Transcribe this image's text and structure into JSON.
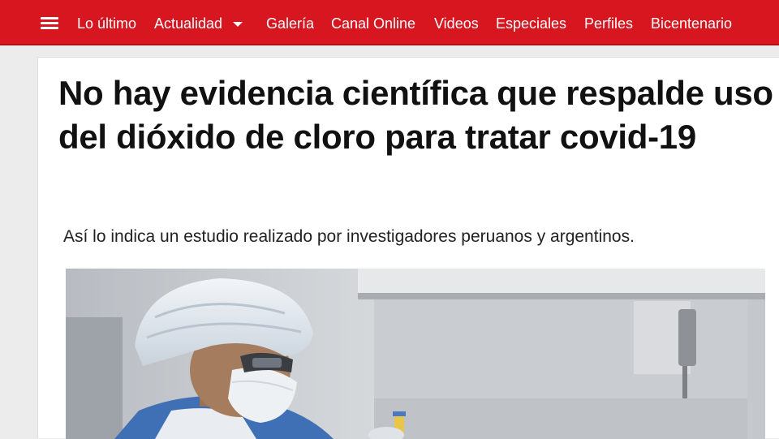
{
  "nav": {
    "items": [
      {
        "label": "Lo último"
      },
      {
        "label": "Actualidad"
      },
      {
        "label": "Galería"
      },
      {
        "label": "Canal Online"
      },
      {
        "label": "Videos"
      },
      {
        "label": "Especiales"
      },
      {
        "label": "Perfiles"
      },
      {
        "label": "Bicentenario"
      }
    ],
    "menu_icon": "hamburger-menu-icon",
    "dropdown_icon": "caret-down-icon"
  },
  "article": {
    "headline": "No hay evidencia científica que respalde uso del dióxido de cloro para tratar covid-19",
    "subtitle": "Así lo indica un estudio realizado por investigadores peruanos y argentinos."
  },
  "colors": {
    "brand_red": "#d8161f",
    "nav_text": "#ffffff",
    "headline_text": "#111111"
  }
}
